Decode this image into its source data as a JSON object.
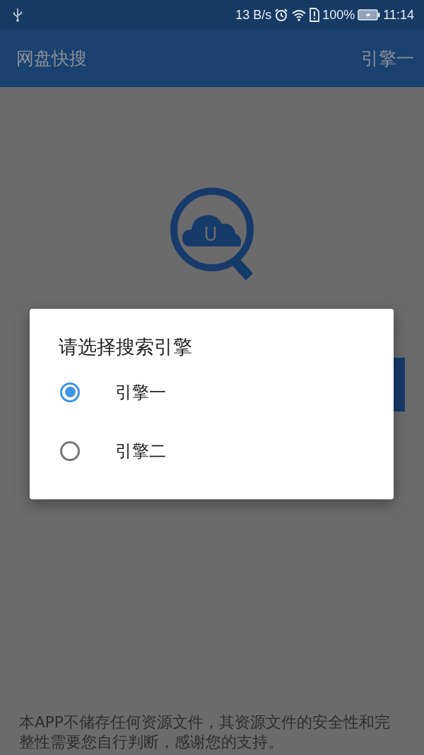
{
  "status_bar": {
    "network_speed": "13 B/s",
    "battery": "100%",
    "time": "11:14"
  },
  "app_bar": {
    "title": "网盘快搜",
    "engine": "引擎一"
  },
  "logo": {
    "letter": "U"
  },
  "dialog": {
    "title": "请选择搜索引擎",
    "options": [
      {
        "label": "引擎一",
        "selected": true
      },
      {
        "label": "引擎二",
        "selected": false
      }
    ]
  },
  "disclaimer": "本APP不储存任何资源文件，其资源文件的安全性和完整性需要您自行判断，感谢您的支持。"
}
